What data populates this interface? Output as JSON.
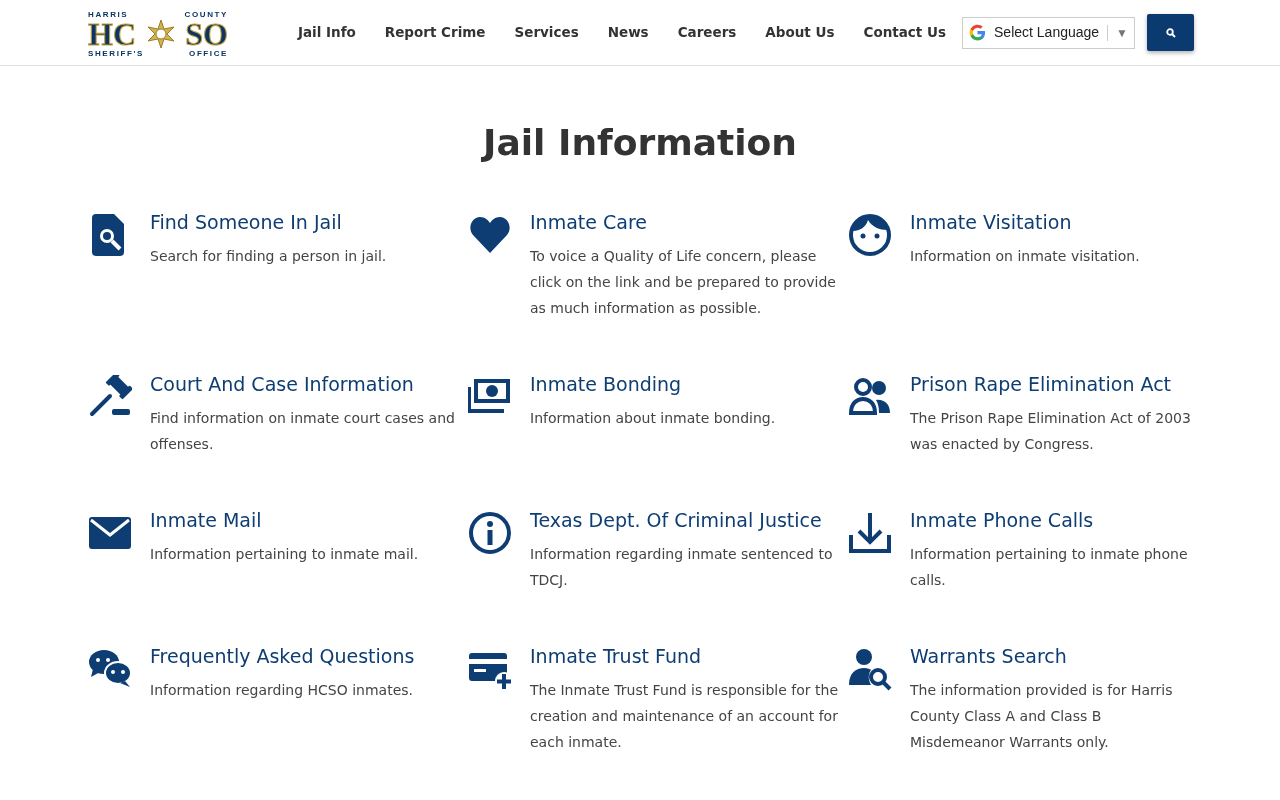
{
  "logo": {
    "top_left": "HARRIS",
    "top_right": "COUNTY",
    "left": "HC",
    "right": "SO",
    "bottom_left": "SHERIFF'S",
    "bottom_right": "OFFICE"
  },
  "nav": [
    {
      "label": "Jail Info"
    },
    {
      "label": "Report Crime"
    },
    {
      "label": "Services"
    },
    {
      "label": "News"
    },
    {
      "label": "Careers"
    },
    {
      "label": "About Us"
    },
    {
      "label": "Contact Us"
    }
  ],
  "language": {
    "label": "Select Language",
    "arrow": "▼"
  },
  "page_title": "Jail Information",
  "items": [
    {
      "kind": "find",
      "title": "Find Someone In Jail",
      "text": "Search for finding a person in jail."
    },
    {
      "kind": "heart",
      "title": "Inmate Care",
      "text": "To voice a Quality of Life concern, please click on the link and be prepared to provide as much information as possible."
    },
    {
      "kind": "face",
      "title": "Inmate Visitation",
      "text": "Information on inmate visitation."
    },
    {
      "kind": "gavel",
      "title": "Court And Case Information",
      "text": "Find information on inmate court cases and offenses."
    },
    {
      "kind": "money",
      "title": "Inmate Bonding",
      "text": "Information about inmate bonding."
    },
    {
      "kind": "people",
      "title": "Prison Rape Elimination Act",
      "text": "The Prison Rape Elimination Act of 2003 was enacted by Congress."
    },
    {
      "kind": "mail",
      "title": "Inmate Mail",
      "text": "Information pertaining to inmate mail."
    },
    {
      "kind": "info",
      "title": "Texas Dept. Of Criminal Justice",
      "text": "Information regarding inmate sentenced to TDCJ."
    },
    {
      "kind": "download",
      "title": "Inmate Phone Calls",
      "text": "Information pertaining to inmate phone calls."
    },
    {
      "kind": "chat",
      "title": "Frequently Asked Questions",
      "text": "Information regarding HCSO inmates."
    },
    {
      "kind": "card",
      "title": "Inmate Trust Fund",
      "text": "The Inmate Trust Fund is responsible for the creation and maintenance of an account for each inmate."
    },
    {
      "kind": "usersearch",
      "title": "Warrants Search",
      "text": "The information provided is for Harris County Class A and Class B Misdemeanor Warrants only."
    }
  ]
}
